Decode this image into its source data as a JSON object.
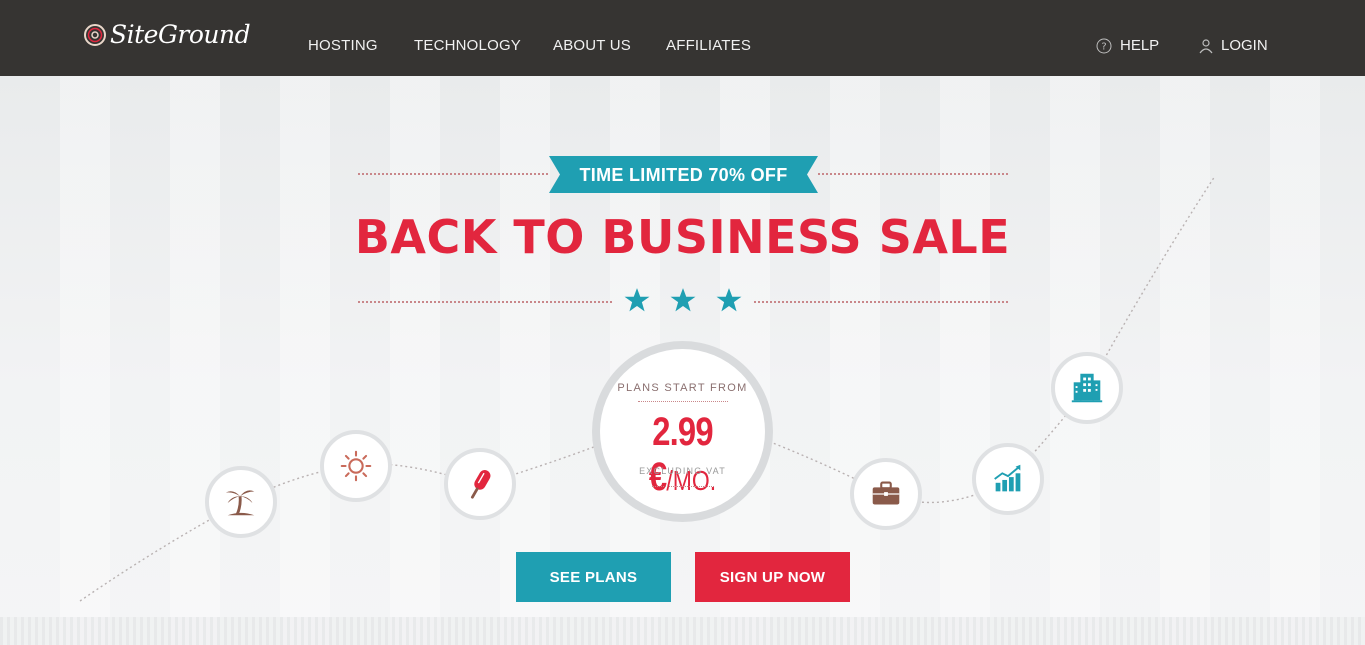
{
  "header": {
    "logo_text": "SiteGround",
    "nav": [
      "HOSTING",
      "TECHNOLOGY",
      "ABOUT US",
      "AFFILIATES"
    ],
    "help_label": "HELP",
    "login_label": "LOGIN"
  },
  "promo": {
    "badge": "TIME LIMITED 70% OFF",
    "headline": "BACK TO BUSINESS SALE",
    "star_count": 3
  },
  "price": {
    "top_label": "PLANS START FROM",
    "amount": "2.99 €",
    "unit": "/MO.",
    "note": "EXCLUDING VAT"
  },
  "icons": [
    "palm-tree-icon",
    "sun-icon",
    "popsicle-icon",
    "briefcase-icon",
    "growth-chart-icon",
    "office-building-icon"
  ],
  "buttons": {
    "see_plans": "SEE PLANS",
    "sign_up": "SIGN UP NOW"
  },
  "colors": {
    "header_bg": "#363432",
    "accent_red": "#e2263e",
    "accent_teal": "#1f9fb2",
    "icon_brown": "#8a5a4a"
  }
}
